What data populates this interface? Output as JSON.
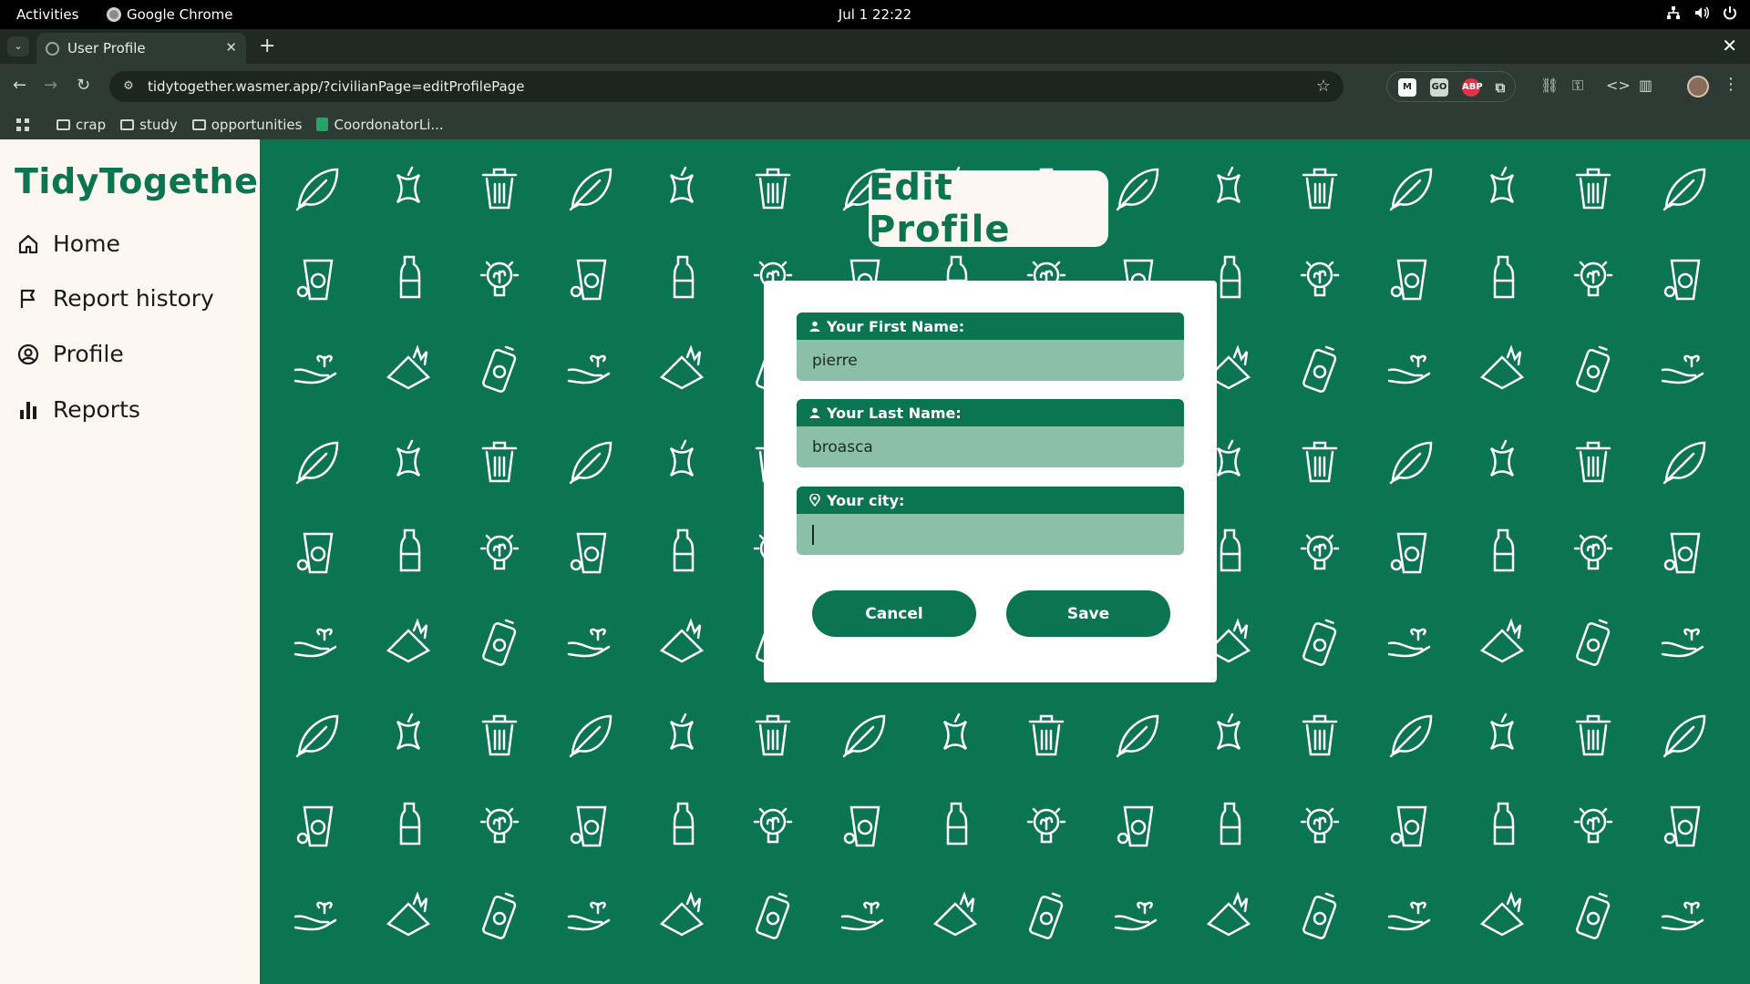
{
  "os": {
    "activities": "Activities",
    "app_name": "Google Chrome",
    "clock": "Jul 1  22:22"
  },
  "browser": {
    "tab_title": "User Profile",
    "url": "tidytogether.wasmer.app/?civilianPage=editProfilePage",
    "bookmarks": [
      "crap",
      "study",
      "opportunities",
      "CoordonatorLi..."
    ],
    "extensions": [
      "M",
      "GO",
      "ABP"
    ]
  },
  "app": {
    "brand": "TidyTogether",
    "nav": [
      {
        "label": "Home",
        "icon": "home-icon"
      },
      {
        "label": "Report history",
        "icon": "flag-icon"
      },
      {
        "label": "Profile",
        "icon": "user-circle-icon"
      },
      {
        "label": "Reports",
        "icon": "bar-chart-icon"
      }
    ],
    "page_title": "Edit Profile",
    "form": {
      "first_name_label": "Your First Name:",
      "first_name_value": "pierre",
      "last_name_label": "Your Last Name:",
      "last_name_value": "broasca",
      "city_label": "Your city:",
      "city_value": "",
      "cancel_label": "Cancel",
      "save_label": "Save"
    },
    "colors": {
      "brand_green": "#0b7450",
      "cream": "#fcf7f0",
      "input_bg": "#8bbfa8"
    }
  }
}
